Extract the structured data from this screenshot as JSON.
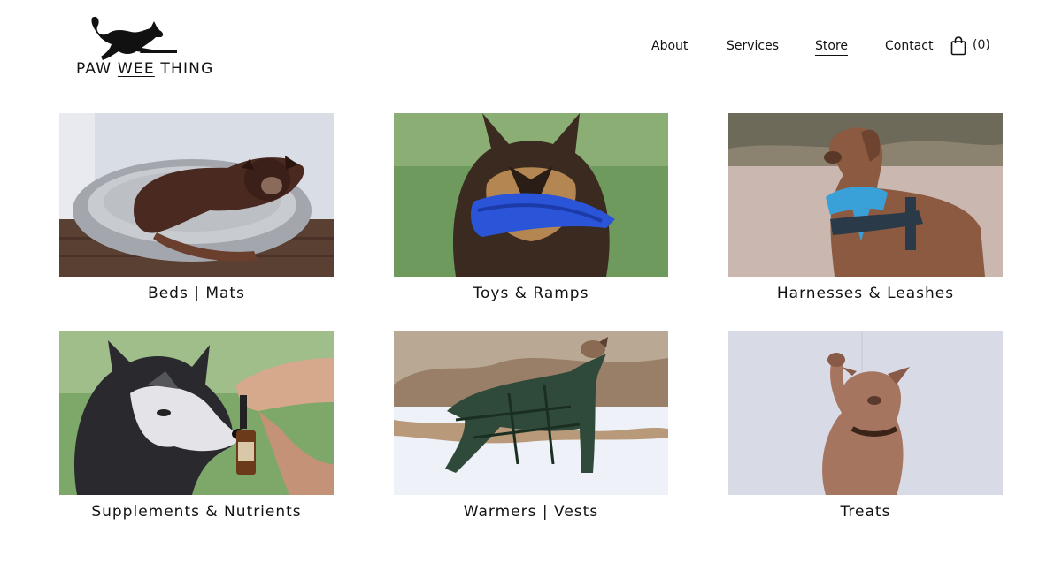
{
  "brand": {
    "logo_text_pre": "PAW ",
    "logo_text_mid": "WEE",
    "logo_text_post": " THING",
    "logo_icon": "dog-silhouette-icon"
  },
  "nav": {
    "items": [
      {
        "label": "About",
        "active": false
      },
      {
        "label": "Services",
        "active": false
      },
      {
        "label": "Store",
        "active": true
      },
      {
        "label": "Contact",
        "active": false
      }
    ],
    "cart_icon": "shopping-bag-icon",
    "cart_count": "(0)"
  },
  "categories": [
    {
      "label": "Beds | Mats",
      "image": "dog lying in a grey pet bed"
    },
    {
      "label": "Toys & Ramps",
      "image": "german shepherd holding blue toy"
    },
    {
      "label": "Harnesses & Leashes",
      "image": "brown dog with blue bandana and harness"
    },
    {
      "label": "Supplements & Nutrients",
      "image": "husky sniffing supplement dropper"
    },
    {
      "label": "Warmers | Vests",
      "image": "greyhound in plaid coat in snow"
    },
    {
      "label": "Treats",
      "image": "dog raising paw against white wall"
    }
  ],
  "colors": {
    "text": "#111111",
    "toy_blue": "#2a55d8",
    "bandana_blue": "#3aa0d8"
  }
}
